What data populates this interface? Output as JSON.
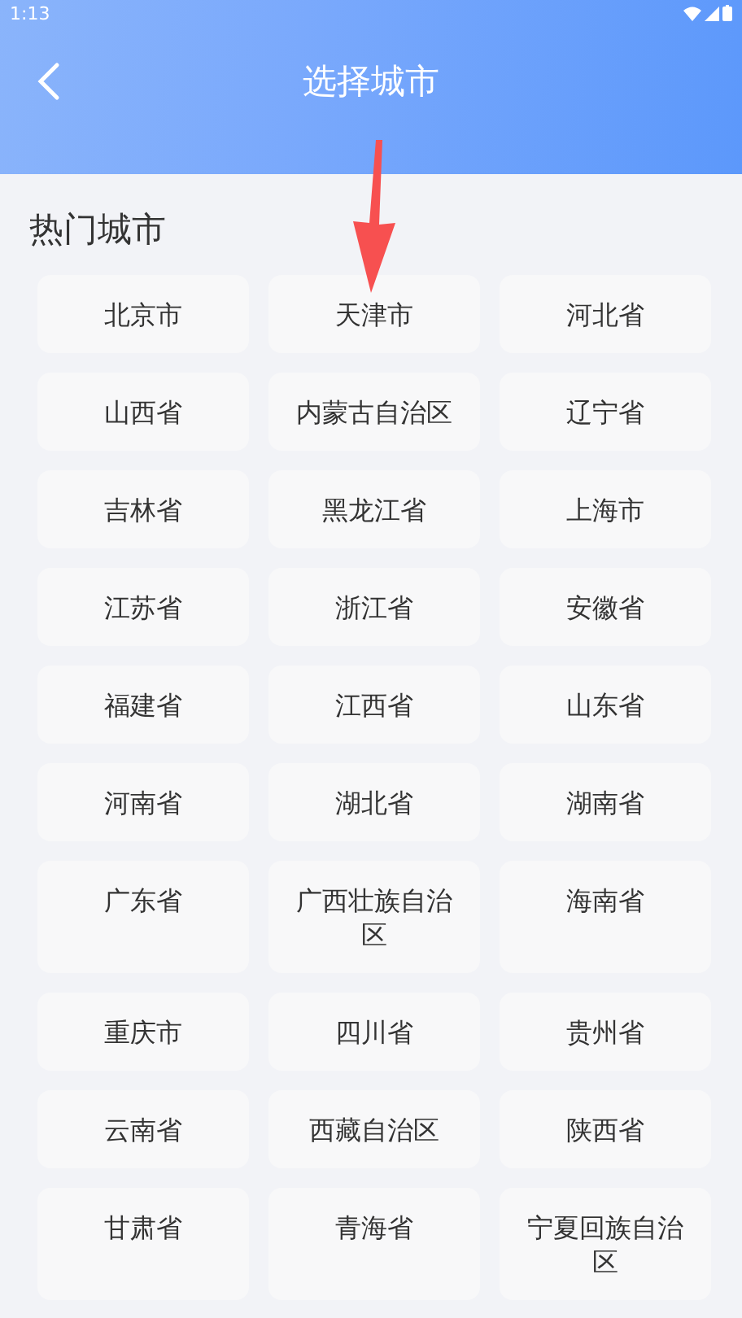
{
  "status_bar": {
    "time": "1:13"
  },
  "header": {
    "title": "选择城市"
  },
  "section": {
    "title": "热门城市"
  },
  "cities": [
    "北京市",
    "天津市",
    "河北省",
    "山西省",
    "内蒙古自治区",
    "辽宁省",
    "吉林省",
    "黑龙江省",
    "上海市",
    "江苏省",
    "浙江省",
    "安徽省",
    "福建省",
    "江西省",
    "山东省",
    "河南省",
    "湖北省",
    "湖南省",
    "广东省",
    "广西壮族自治区",
    "海南省",
    "重庆市",
    "四川省",
    "贵州省",
    "云南省",
    "西藏自治区",
    "陕西省",
    "甘肃省",
    "青海省",
    "宁夏回族自治区"
  ]
}
